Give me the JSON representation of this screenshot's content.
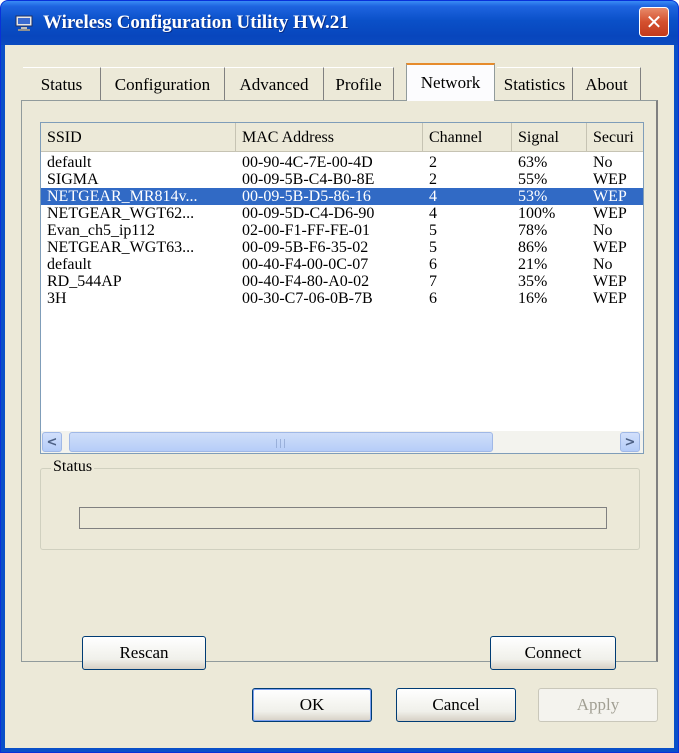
{
  "window": {
    "title": "Wireless Configuration Utility HW.21"
  },
  "tabs": [
    "Status",
    "Configuration",
    "Advanced",
    "Profile",
    "Network",
    "Statistics",
    "About"
  ],
  "active_tab": "Network",
  "columns": [
    "SSID",
    "MAC Address",
    "Channel",
    "Signal",
    "Securi"
  ],
  "networks": [
    {
      "ssid": "default",
      "mac": "00-90-4C-7E-00-4D",
      "channel": "2",
      "signal": "63%",
      "security": "No"
    },
    {
      "ssid": "SIGMA",
      "mac": "00-09-5B-C4-B0-8E",
      "channel": "2",
      "signal": "55%",
      "security": "WEP"
    },
    {
      "ssid": "NETGEAR_MR814v...",
      "mac": "00-09-5B-D5-86-16",
      "channel": "4",
      "signal": "53%",
      "security": "WEP"
    },
    {
      "ssid": "NETGEAR_WGT62...",
      "mac": "00-09-5D-C4-D6-90",
      "channel": "4",
      "signal": "100%",
      "security": "WEP"
    },
    {
      "ssid": "Evan_ch5_ip112",
      "mac": "02-00-F1-FF-FE-01",
      "channel": "5",
      "signal": "78%",
      "security": "No"
    },
    {
      "ssid": "NETGEAR_WGT63...",
      "mac": "00-09-5B-F6-35-02",
      "channel": "5",
      "signal": "86%",
      "security": "WEP"
    },
    {
      "ssid": "default",
      "mac": "00-40-F4-00-0C-07",
      "channel": "6",
      "signal": "21%",
      "security": "No"
    },
    {
      "ssid": "RD_544AP",
      "mac": "00-40-F4-80-A0-02",
      "channel": "7",
      "signal": "35%",
      "security": "WEP"
    },
    {
      "ssid": "3H",
      "mac": "00-30-C7-06-0B-7B",
      "channel": "6",
      "signal": "16%",
      "security": "WEP"
    }
  ],
  "selected_index": 2,
  "status_group": {
    "label": "Status",
    "progress": 0
  },
  "buttons": {
    "rescan": "Rescan",
    "connect": "Connect",
    "ok": "OK",
    "cancel": "Cancel",
    "apply": "Apply"
  },
  "colors": {
    "titlebar": "#0a50c8",
    "selection": "#316ac5",
    "close": "#d4502e",
    "active_tab_accent": "#e68b2c"
  }
}
